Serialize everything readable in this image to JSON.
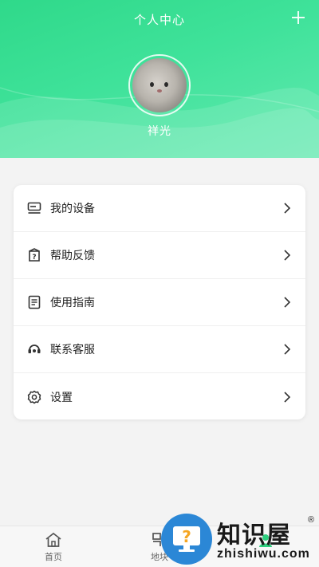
{
  "header": {
    "title": "个人中心",
    "username": "祥光",
    "gradient_colors": [
      "#2fd98a",
      "#62e9b0"
    ]
  },
  "menu": {
    "items": [
      {
        "label": "我的设备",
        "icon": "device-icon"
      },
      {
        "label": "帮助反馈",
        "icon": "help-icon"
      },
      {
        "label": "使用指南",
        "icon": "guide-icon"
      },
      {
        "label": "联系客服",
        "icon": "support-icon"
      },
      {
        "label": "设置",
        "icon": "gear-icon"
      }
    ]
  },
  "bottom_nav": {
    "items": [
      {
        "label": "首页",
        "icon": "home-icon"
      },
      {
        "label": "地块",
        "icon": "plot-icon"
      },
      {
        "label": "",
        "icon": "profile-icon",
        "active": true
      }
    ]
  },
  "watermark": {
    "name": "知识屋",
    "domain": "zhishiwu.com",
    "reg": "®"
  }
}
